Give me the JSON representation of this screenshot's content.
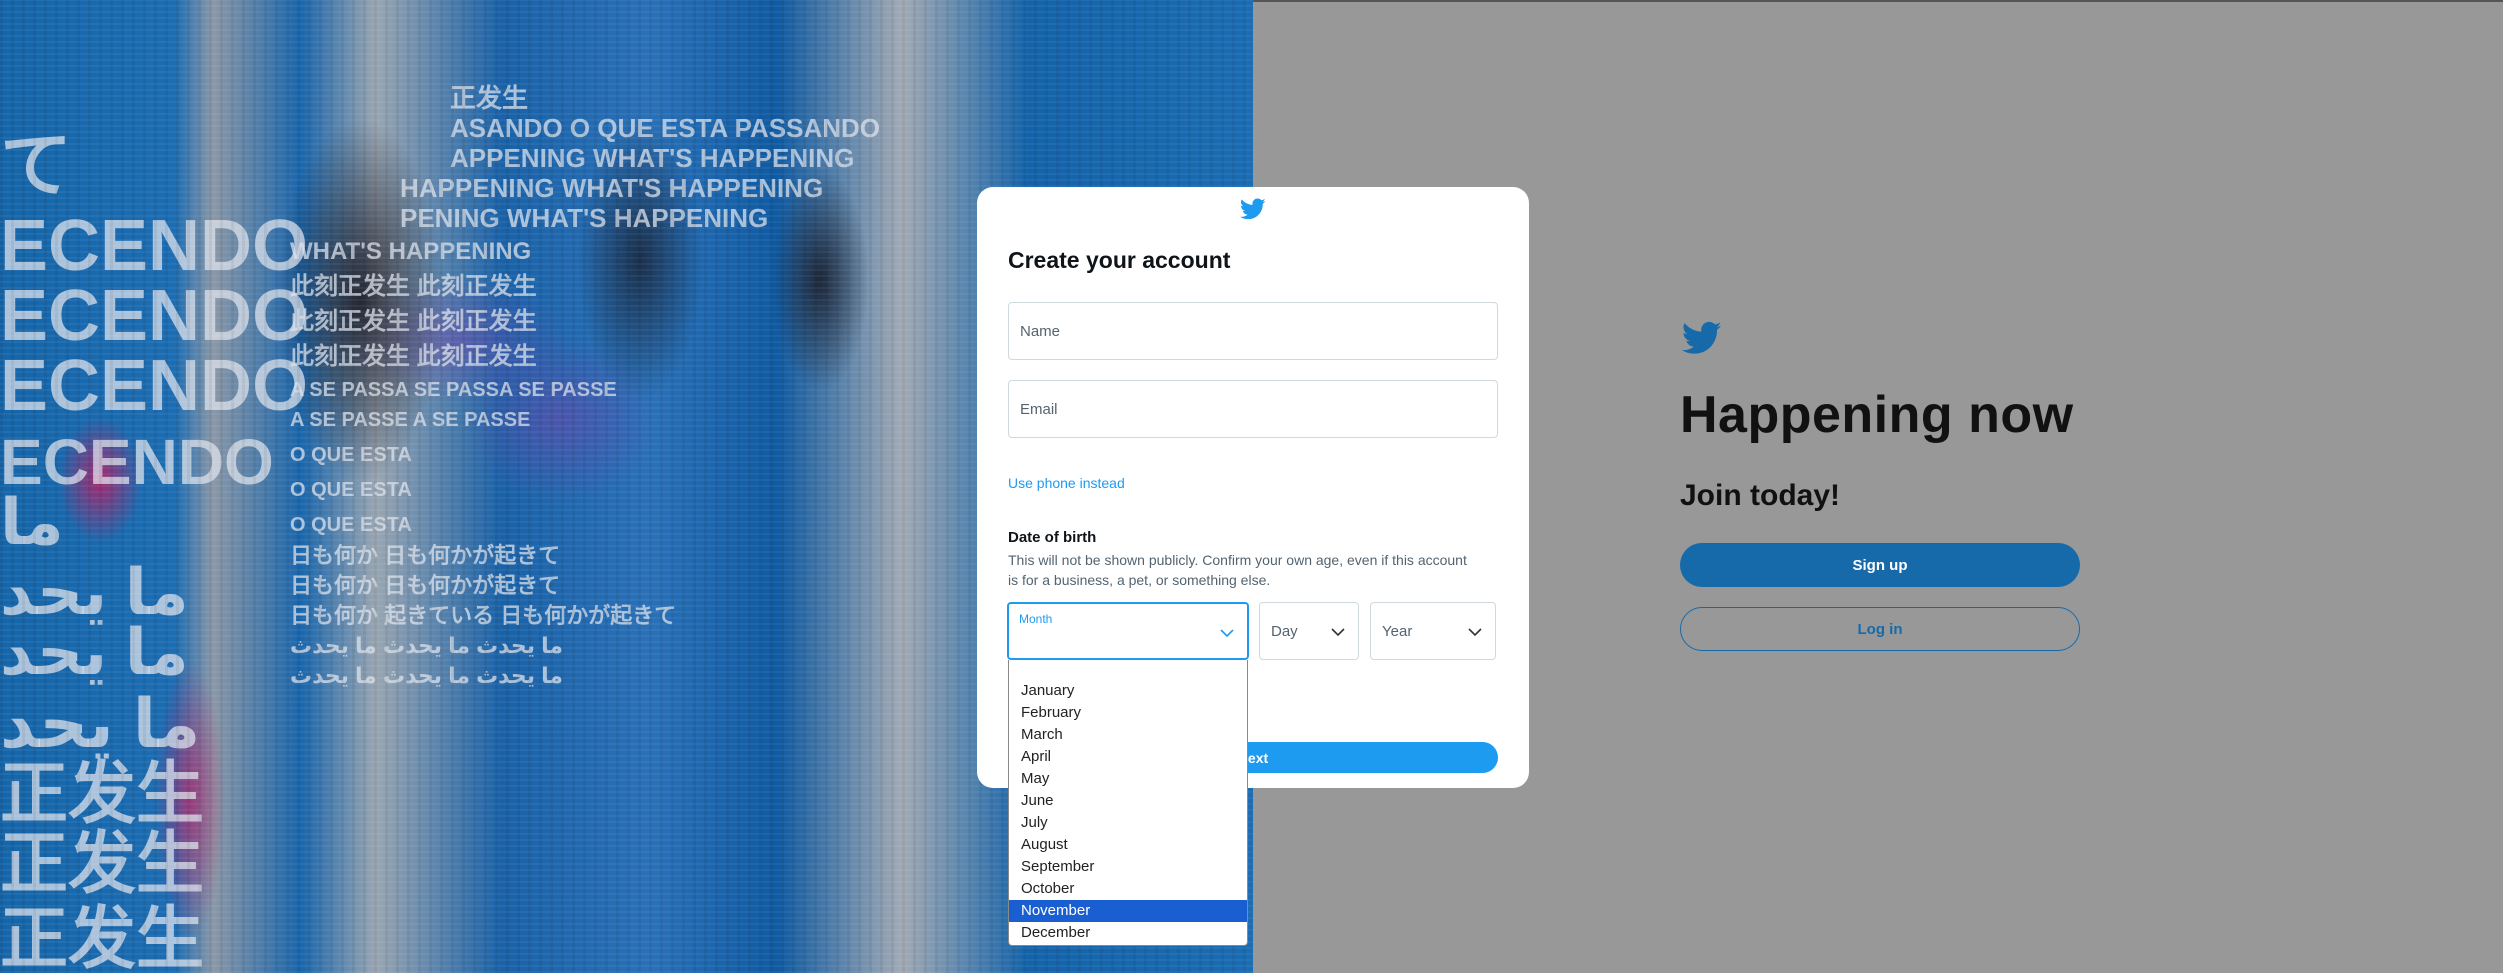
{
  "art": {
    "lines": [
      "て",
      "ECENDO",
      "ECENDO",
      "ECENDO",
      "ECENDO",
      "ما",
      "ما يحد",
      "ما يحد",
      "ما يحد",
      "正发生",
      "正发生",
      "正发生",
      "正发生",
      "ASANDO O QUE ESTA PASSANDO",
      "APPENING WHAT'S HAPPENING",
      "HAPPENING WHAT'S HAPPENING",
      "PENING WHAT'S HAPPENING",
      "WHAT'S HAPPENING",
      "此刻正发生 此刻正发生",
      "此刻正发生 此刻正发生",
      "此刻正发生 此刻正发生",
      "A SE PASSA SE PASSA SE PASSE",
      "A SE PASSE A SE PASSE",
      "O QUE ESTA",
      "O QUE ESTA",
      "O QUE ESTA",
      "日も何か 日も何かが起きて",
      "日も何か 日も何かが起きて",
      "日も何か 起きている 日も何かが起きて",
      "ما يحدث ما يحدث ما يحدث",
      "ما يحدث ما يحدث ما يحدث"
    ]
  },
  "landing": {
    "headline": "Happening now",
    "join": "Join today!",
    "signup_label": "Sign up",
    "login_label": "Log in"
  },
  "modal": {
    "title": "Create your account",
    "name_placeholder": "Name",
    "email_placeholder": "Email",
    "use_phone": "Use phone instead",
    "dob_title": "Date of birth",
    "dob_note": "This will not be shown publicly. Confirm your own age, even if this account is for a business, a pet, or something else.",
    "month_label": "Month",
    "day_label": "Day",
    "year_label": "Year",
    "next_label": "Next"
  },
  "dropdown": {
    "options": [
      "January",
      "February",
      "March",
      "April",
      "May",
      "June",
      "July",
      "August",
      "September",
      "October",
      "November",
      "December"
    ],
    "selected_index": 10
  },
  "colors": {
    "twitter_blue": "#1d9bf0",
    "landing_button": "#176aaa",
    "option_highlight": "#1a5fd1"
  }
}
